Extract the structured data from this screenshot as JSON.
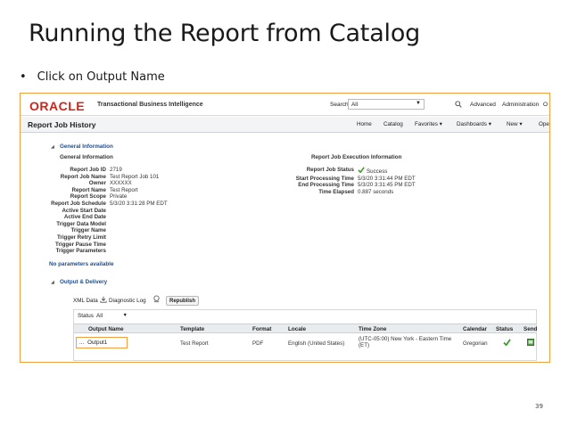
{
  "slide": {
    "title": "Running the Report from Catalog",
    "bullet_mark": "•",
    "bullet": "Click on Output Name",
    "page_number": "39"
  },
  "topbar": {
    "logo": "ORACLE",
    "app_title": "Transactional Business Intelligence",
    "search_label": "Search",
    "search_scope": "All",
    "advanced": "Advanced",
    "administration": "Administration",
    "overflow": "O"
  },
  "subbar": {
    "heading": "Report Job History",
    "home": "Home",
    "catalog": "Catalog",
    "favorites": "Favorites ▾",
    "dashboards": "Dashboards ▾",
    "new": "New ▾",
    "open": "Ope"
  },
  "general": {
    "section_title": "General Information",
    "sub_title": "General Information",
    "fields": [
      {
        "k": "Report Job ID",
        "v": "2719"
      },
      {
        "k": "Report Job Name",
        "v": "Test Report Job 101"
      },
      {
        "k": "Owner",
        "v": "XXXXXX"
      },
      {
        "k": "Report Name",
        "v": "Test Report"
      },
      {
        "k": "Report Scope",
        "v": "Private"
      },
      {
        "k": "Report Job Schedule",
        "v": "5/3/20 3:31:28 PM EDT"
      },
      {
        "k": "Active Start Date",
        "v": ""
      },
      {
        "k": "Active End Date",
        "v": ""
      },
      {
        "k": "Trigger Data Model",
        "v": ""
      },
      {
        "k": "Trigger Name",
        "v": ""
      },
      {
        "k": "Trigger Retry Limit",
        "v": ""
      },
      {
        "k": "Trigger Pause Time",
        "v": ""
      },
      {
        "k": "Trigger Parameters",
        "v": ""
      }
    ],
    "exec_title": "Report Job Execution Information",
    "exec_fields": [
      {
        "k": "Report Job Status",
        "v": "Success"
      },
      {
        "k": "Start Processing Time",
        "v": "5/3/20 3:31:44 PM EDT"
      },
      {
        "k": "End Processing Time",
        "v": "5/3/20 3:31:45 PM EDT"
      },
      {
        "k": "Time Elapsed",
        "v": "0.887 seconds"
      }
    ]
  },
  "params": {
    "text": "No parameters available"
  },
  "output": {
    "section_title": "Output & Delivery",
    "xml_data": "XML Data",
    "diagnostic_log": "Diagnostic Log",
    "republish": "Republish",
    "status_label": "Status",
    "status_value": "All",
    "columns": [
      "Output Name",
      "Template",
      "Format",
      "Locale",
      "Time Zone",
      "Calendar",
      "Status",
      "Send"
    ],
    "row": {
      "ellipsis": "...",
      "output_name": "Output1",
      "template": "Test Report",
      "format": "PDF",
      "locale": "English (United States)",
      "time_zone_1": "(UTC-05:00) New York - Eastern Time",
      "time_zone_2": "(ET)",
      "calendar": "Gregorian"
    }
  },
  "colors": {
    "accent_orange": "#f0a040",
    "oracle_red": "#d0251a",
    "link_blue": "#1f4e8c",
    "success_green": "#3a9a2a"
  }
}
